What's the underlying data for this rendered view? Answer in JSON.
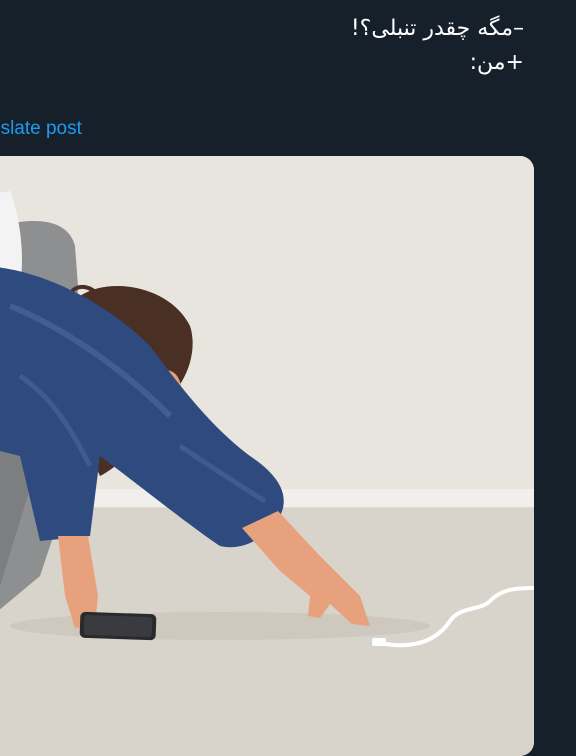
{
  "post": {
    "lines": [
      "–مگه چقدر تنبلی؟!",
      "+من:"
    ]
  },
  "translate_label": "nslate post",
  "media": {
    "wall_color": "#e8e5df",
    "floor_color": "#d9d4cb",
    "baseboard_color": "#f1efeb",
    "sofa_color": "#8e8f91",
    "shirt_color": "#2e4a7e",
    "skin_color": "#e7a27d",
    "hair_color": "#4a2f24",
    "phone_color": "#2a2a2c",
    "cable_color": "#ffffff"
  }
}
